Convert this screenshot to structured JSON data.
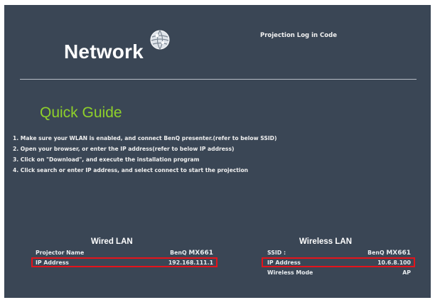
{
  "header": {
    "title": "Network",
    "login_code_label": "Projection Log in Code"
  },
  "guide": {
    "title": "Quick Guide",
    "steps": [
      "1. Make sure your WLAN is enabled, and connect BenQ presenter.(refer to below SSID)",
      "2. Open your browser, or enter the IP address(refer to below IP address)",
      "3. Click on \"Download\", and execute the installation program",
      "4. Click search or enter IP address, and select connect to start the projection"
    ]
  },
  "wired": {
    "title": "Wired LAN",
    "rows": [
      {
        "label": "Projector Name",
        "brand": "BenQ",
        "model": "MX661"
      },
      {
        "label": "IP Address",
        "value": "192.168.111.1"
      }
    ]
  },
  "wireless": {
    "title": "Wireless LAN",
    "rows": [
      {
        "label": "SSID :",
        "brand": "BenQ",
        "model": "MX661"
      },
      {
        "label": "IP Address",
        "value": "10.6.8.100"
      },
      {
        "label": "Wireless Mode",
        "value": "AP"
      }
    ]
  },
  "colors": {
    "background": "#3a4655",
    "accent_green": "#8fd12a",
    "highlight_red": "#e4141b"
  },
  "icons": {
    "network_logo": "globe-icon"
  }
}
